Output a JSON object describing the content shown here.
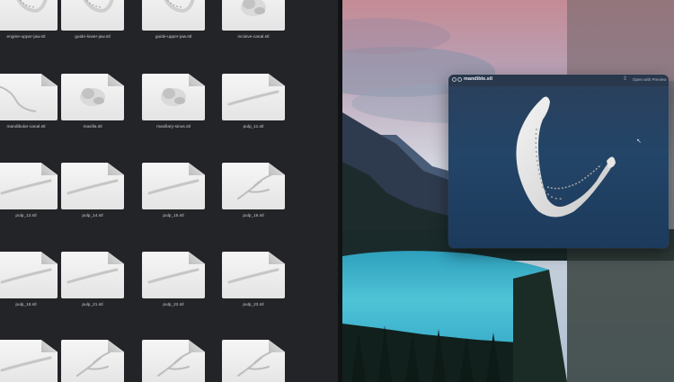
{
  "finder": {
    "files": [
      {
        "name": "engine-upper-jaw.stl",
        "shape": "jaw"
      },
      {
        "name": "guide-lower-jaw.stl",
        "shape": "jaw"
      },
      {
        "name": "guide-upper-jaw.stl",
        "shape": "jaw"
      },
      {
        "name": "incisive-canal.stl",
        "shape": "blob"
      },
      {
        "name": "mandibular-canal.stl",
        "shape": "curve"
      },
      {
        "name": "maxilla.stl",
        "shape": "blob"
      },
      {
        "name": "maxillary-sinus.stl",
        "shape": "blob"
      },
      {
        "name": "pulp_11.stl",
        "shape": "rod"
      },
      {
        "name": "pulp_13.stl",
        "shape": "rod"
      },
      {
        "name": "pulp_14.stl",
        "shape": "rod"
      },
      {
        "name": "pulp_15.stl",
        "shape": "rod"
      },
      {
        "name": "pulp_16.stl",
        "shape": "branch"
      },
      {
        "name": "pulp_18.stl",
        "shape": "rod"
      },
      {
        "name": "pulp_21.stl",
        "shape": "rod"
      },
      {
        "name": "pulp_22.stl",
        "shape": "rod"
      },
      {
        "name": "pulp_23.stl",
        "shape": "rod"
      },
      {
        "name": "",
        "shape": "rod"
      },
      {
        "name": "",
        "shape": "branch"
      },
      {
        "name": "",
        "shape": "branch"
      },
      {
        "name": "",
        "shape": "branch"
      }
    ]
  },
  "preview": {
    "title": "mandible.stl",
    "open_with": "Open with Preview",
    "share_icon": "share-icon"
  },
  "colors": {
    "finder_bg": "#232427",
    "preview_bg": "#234568",
    "water": "#4fc3d6"
  }
}
